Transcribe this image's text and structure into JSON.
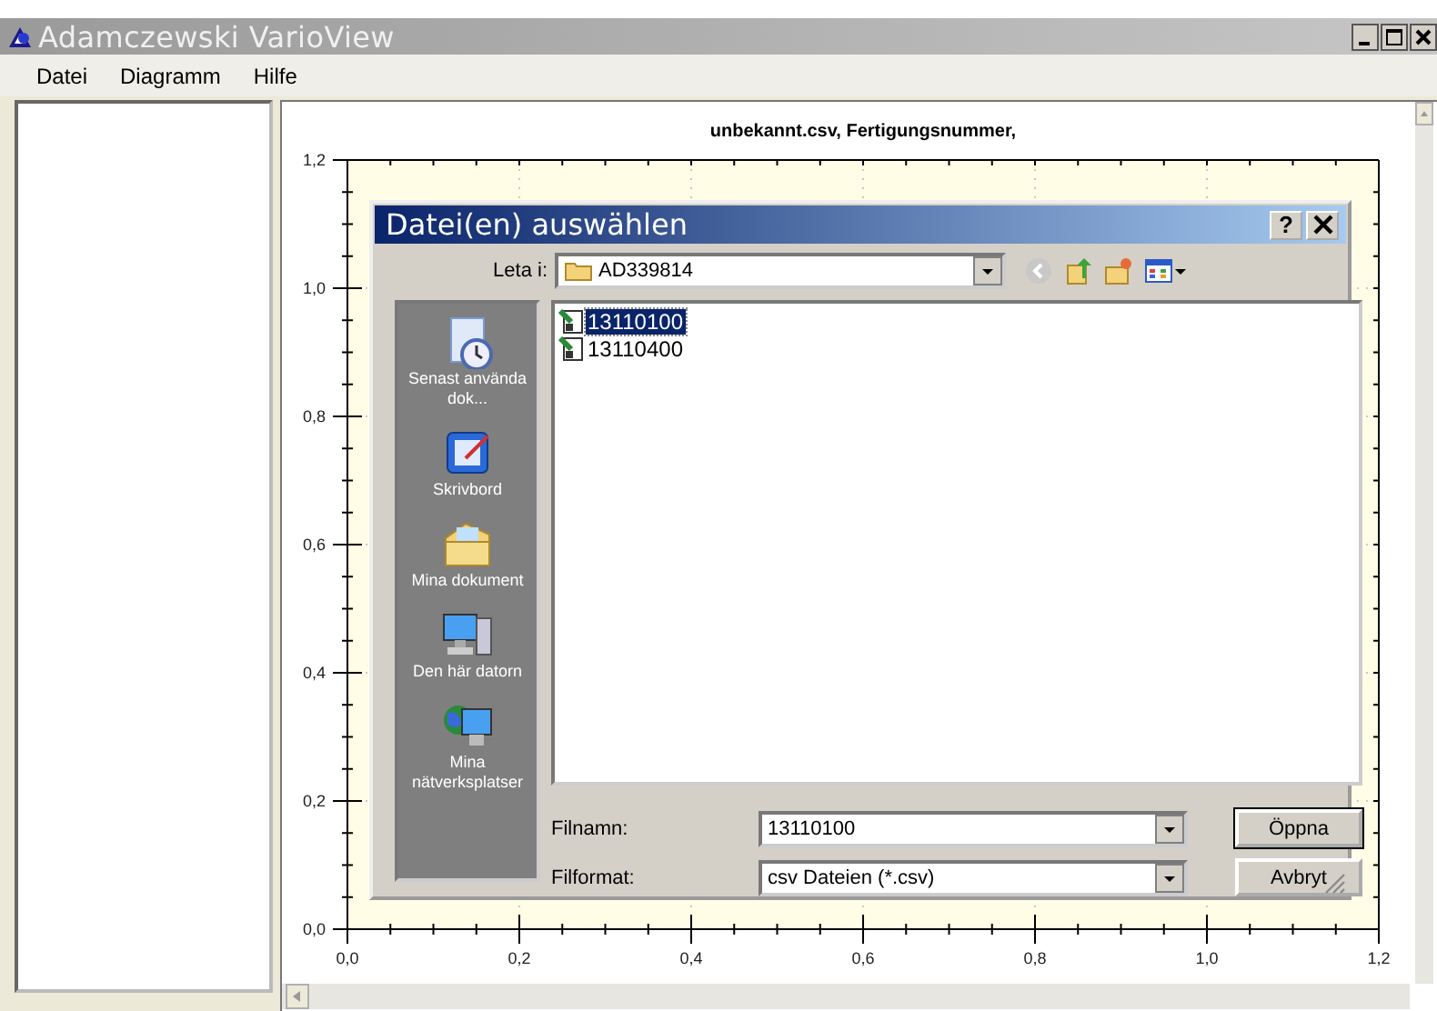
{
  "window": {
    "title": "Adamczewski VarioView"
  },
  "menu": [
    "Datei",
    "Diagramm",
    "Hilfe"
  ],
  "chart_data": {
    "type": "line",
    "grid": true,
    "title": "unbekannt.csv, Fertigungsnummer,",
    "xlim": [
      0,
      1.2
    ],
    "ylim": [
      0,
      1.2
    ],
    "xticks": [
      {
        "value": 0,
        "label": "0,0"
      },
      {
        "value": 0.2,
        "label": "0,2"
      },
      {
        "value": 0.4,
        "label": "0,4"
      },
      {
        "value": 0.6,
        "label": "0,6"
      },
      {
        "value": 0.8,
        "label": "0,8"
      },
      {
        "value": 1.0,
        "label": "1,0"
      },
      {
        "value": 1.2,
        "label": "1,2"
      }
    ],
    "yticks": [
      {
        "value": 0,
        "label": "0,0"
      },
      {
        "value": 0.2,
        "label": "0,2"
      },
      {
        "value": 0.4,
        "label": "0,4"
      },
      {
        "value": 0.6,
        "label": "0,6"
      },
      {
        "value": 0.8,
        "label": "0,8"
      },
      {
        "value": 1.0,
        "label": "1,0"
      },
      {
        "value": 1.2,
        "label": "1,2"
      }
    ]
  },
  "dialog": {
    "title": "Datei(en) auswählen",
    "help": "?",
    "look_in": {
      "label": "Leta i:",
      "value": "AD339814"
    },
    "places": [
      {
        "kind": "recent",
        "label": "Senast använda dok..."
      },
      {
        "kind": "desktop",
        "label": "Skrivbord"
      },
      {
        "kind": "documents",
        "label": "Mina dokument"
      },
      {
        "kind": "computer",
        "label": "Den här datorn"
      },
      {
        "kind": "network",
        "label": "Mina nätverksplatser"
      }
    ],
    "files": [
      {
        "name": "13110100",
        "selected": true
      },
      {
        "name": "13110400",
        "selected": false
      }
    ],
    "file_name": {
      "label": "Filnamn:",
      "value": "13110100"
    },
    "file_type": {
      "label": "Filformat:",
      "value": "csv Dateien (*.csv)"
    },
    "buttons": [
      "Öppna",
      "Avbryt"
    ]
  }
}
